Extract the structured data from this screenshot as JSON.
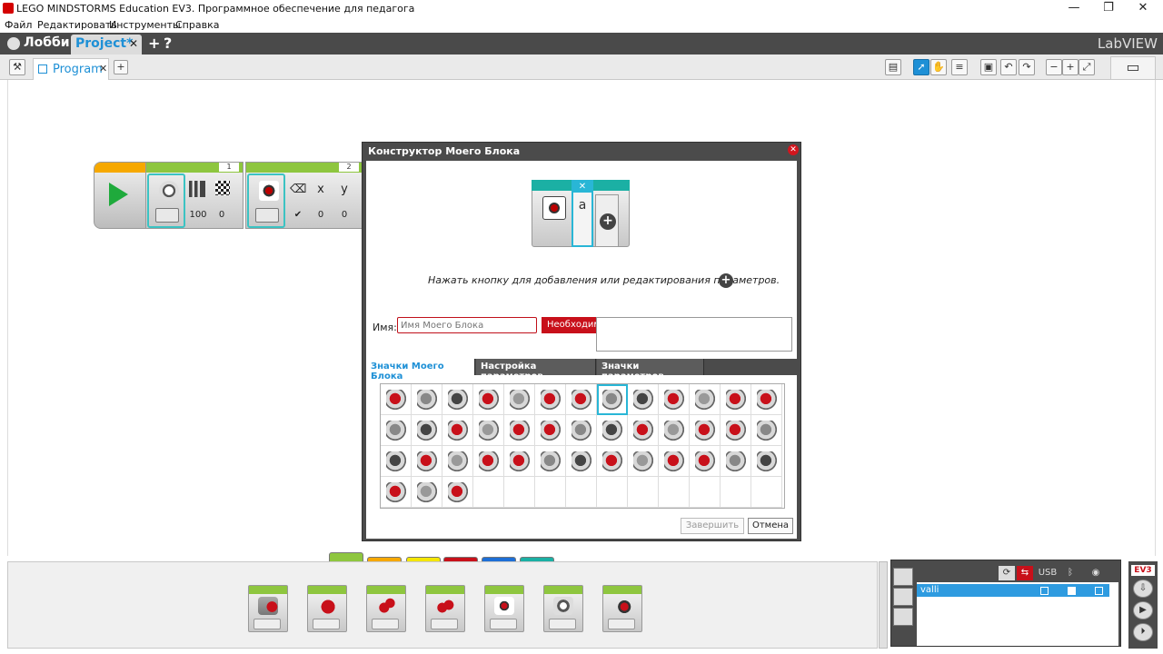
{
  "window": {
    "title": "LEGO MINDSTORMS Education EV3. Программное обеспечение для педагога",
    "minimize": "—",
    "restore": "❐",
    "close": "✕"
  },
  "menu": [
    "Файл",
    "Редактировать",
    "Инструменты",
    "Справка"
  ],
  "project_bar": {
    "lobby": "Лобби",
    "project_tab": "Project*",
    "project_close": "✕",
    "add": "+",
    "help": "?",
    "brand": "LabVIEW"
  },
  "program_tabs": {
    "settings_icon": "wrench-icon",
    "program_tab": "Program",
    "program_close": "✕",
    "add": "+"
  },
  "program_blocks": [
    {
      "number": "1",
      "values": [
        "100",
        "0"
      ]
    },
    {
      "number": "2",
      "values": [
        "0",
        "0"
      ],
      "labels": [
        "x",
        "y"
      ]
    }
  ],
  "dialog": {
    "title": "Конструктор Моего Блока",
    "preview_param": "a",
    "hint": "Нажать кнопку для добавления или редактирования параметров.",
    "name_label": "Имя:",
    "name_placeholder": "Имя Моего Блока",
    "name_value": "",
    "name_error": "Необходимо имя Моего Блока.",
    "tabs": [
      "Значки Моего Блока",
      "Настройка параметров",
      "Значки параметров"
    ],
    "active_tab": 0,
    "icon_names": [
      "brain-red-icon",
      "brain-gray-icon",
      "motor-medium-icon",
      "motor-large-icon",
      "motor-large-2-icon",
      "steering-icon",
      "tank-icon",
      "camera-sensor-icon",
      "gyro-icon",
      "touch-sensor-icon",
      "timer-icon",
      "loop-icon",
      "ultrasonic-icon",
      "motor-gray-icon",
      "motor-gray-2-icon",
      "motor-dark-icon",
      "dpad-icon",
      "motor-gray-3-icon",
      "stopwatch-icon",
      "motor-red-icon",
      "motor-dark-2-icon",
      "battery-icon",
      "stack-icon",
      "briefcase-icon",
      "lock-briefcase-icon",
      "display-icon",
      "math-icon",
      "operations-icon",
      "round-icon",
      "random-icon",
      "range-icon",
      "text-icon",
      "dice-icon",
      "file-icon",
      "oscilloscope-icon",
      "message-icon",
      "bluetooth-icon",
      "bluetooth-off-icon",
      "stop-icon",
      "binary-icon",
      "sound-sensor-icon",
      "random-red-icon"
    ],
    "selected_icon": 7,
    "done": "Завершить",
    "cancel": "Отмена"
  },
  "palette": {
    "tab_colors": [
      "#8ec63f",
      "#f6a800",
      "#f4e600",
      "#c8101a",
      "#1e6fd6",
      "#1bb0a4"
    ],
    "active_tab": 0,
    "blocks": [
      "medium-motor-block",
      "large-motor-block",
      "move-steering-block",
      "move-tank-block",
      "display-block",
      "sound-block",
      "brick-status-light-block"
    ]
  },
  "hardware": {
    "headers": [
      "USB"
    ],
    "brick_name": "valli",
    "brand": "EV3"
  },
  "colors": {
    "accent": "#1e90d6",
    "error": "#c8101a",
    "dark": "#4b4b4b",
    "action_green": "#8ec63f"
  }
}
